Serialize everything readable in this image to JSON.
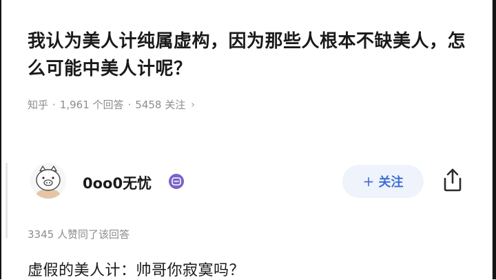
{
  "question": {
    "title": "我认为美人计纯属虚构，因为那些人根本不缺美人，怎么可能中美人计呢？"
  },
  "meta": {
    "platform": "知乎",
    "answers": "1,961 个回答",
    "followers": "5458 关注",
    "chevron": "›"
  },
  "author": {
    "name": "0oo0无忧",
    "avatar_icon": "pig-avatar-icon",
    "badge_icon": "member-badge-icon"
  },
  "actions": {
    "follow_label": "关注",
    "follow_plus": "+",
    "share_icon": "share-icon"
  },
  "answer": {
    "upvote_summary": "3345 人赞同了该回答",
    "first_line": "虚假的美人计：帅哥你寂寞吗？"
  },
  "colors": {
    "accent": "#3f6fd3",
    "follow_bg": "#eef3fc",
    "badge": "#7b62c9",
    "muted_text": "#8c8c8c",
    "text": "#1a1a1a"
  }
}
